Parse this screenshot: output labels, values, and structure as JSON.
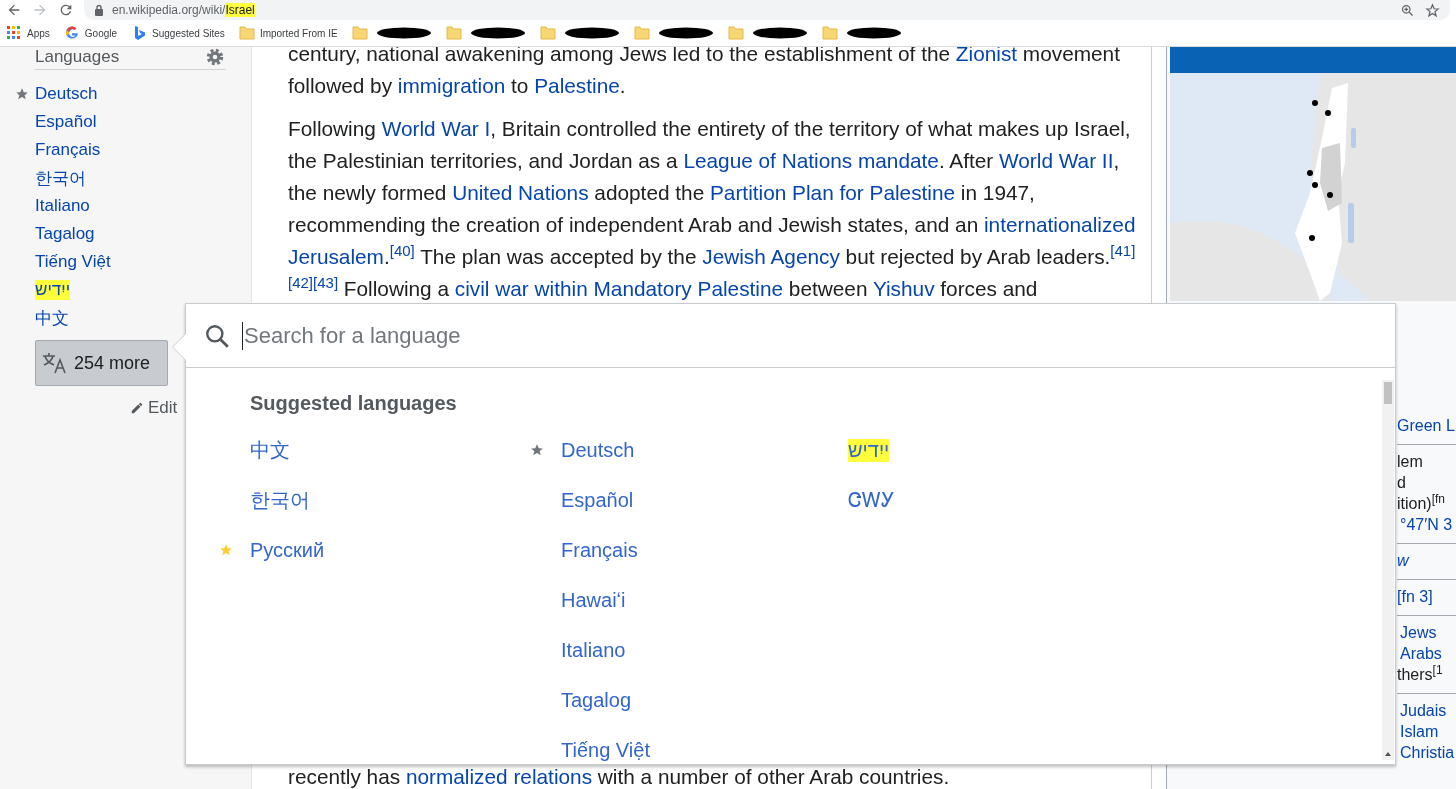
{
  "browser": {
    "nav_buttons": [
      {
        "kind": "back",
        "disabled": false
      },
      {
        "kind": "forward",
        "disabled": true
      },
      {
        "kind": "reload",
        "disabled": false
      }
    ],
    "address": [
      {
        "text": "en.wikipedia.org/wiki/",
        "highlighted": false
      },
      {
        "text": "Israel",
        "highlighted": true
      }
    ],
    "actions": [
      {
        "kind": "zoom"
      },
      {
        "kind": "bookmark"
      }
    ]
  },
  "bookmarks": [
    {
      "kind": "apps",
      "label": "Apps"
    },
    {
      "kind": "google",
      "label": "Google"
    },
    {
      "kind": "bing",
      "label": "Suggested Sites"
    },
    {
      "kind": "folder",
      "label": "Imported From IE"
    },
    {
      "kind": "redacted"
    },
    {
      "kind": "redacted"
    },
    {
      "kind": "redacted"
    },
    {
      "kind": "redacted"
    },
    {
      "kind": "redacted"
    },
    {
      "kind": "redacted"
    }
  ],
  "sidebar": {
    "heading": "Languages",
    "languages": [
      {
        "label": "Deutsch",
        "starred": true,
        "color": "#72777d",
        "highlighted": false
      },
      {
        "label": "Español",
        "starred": false,
        "highlighted": false
      },
      {
        "label": "Français",
        "starred": false,
        "highlighted": false
      },
      {
        "label": "한국어",
        "starred": false,
        "highlighted": false
      },
      {
        "label": "Italiano",
        "starred": false,
        "highlighted": false
      },
      {
        "label": "Tagalog",
        "starred": false,
        "highlighted": false
      },
      {
        "label": "Tiếng Việt",
        "starred": false,
        "highlighted": false
      },
      {
        "label": "ייִדיש",
        "starred": false,
        "highlighted": true
      },
      {
        "label": "中文",
        "starred": false,
        "highlighted": false
      }
    ],
    "more_button": "254 more",
    "edit_link": "Edit"
  },
  "article": {
    "paragraphs": [
      [
        {
          "kind": "text",
          "text": "century, national awakening among Jews led to the establishment of the "
        },
        {
          "kind": "link",
          "text": "Zionist"
        },
        {
          "kind": "text",
          "text": " movement followed by "
        },
        {
          "kind": "link",
          "text": "immigration"
        },
        {
          "kind": "text",
          "text": " to "
        },
        {
          "kind": "link",
          "text": "Palestine"
        },
        {
          "kind": "text",
          "text": "."
        }
      ],
      [
        {
          "kind": "text",
          "text": "Following "
        },
        {
          "kind": "link",
          "text": "World War I"
        },
        {
          "kind": "text",
          "text": ", Britain controlled the entirety of the territory of what makes up Israel, the Palestinian territories, and Jordan as a "
        },
        {
          "kind": "link",
          "text": "League of Nations mandate"
        },
        {
          "kind": "text",
          "text": ". After "
        },
        {
          "kind": "link",
          "text": "World War II"
        },
        {
          "kind": "text",
          "text": ", the newly formed "
        },
        {
          "kind": "link",
          "text": "United Nations"
        },
        {
          "kind": "text",
          "text": " adopted the "
        },
        {
          "kind": "link",
          "text": "Partition Plan for Palestine"
        },
        {
          "kind": "text",
          "text": " in 1947, recommending the creation of independent Arab and Jewish states, and an "
        },
        {
          "kind": "link",
          "text": "internationalized "
        },
        {
          "kind": "link",
          "text": "Jerusalem"
        },
        {
          "kind": "text",
          "text": "."
        },
        {
          "kind": "ref",
          "text": "[40]"
        },
        {
          "kind": "text",
          "text": " The plan was accepted by the "
        },
        {
          "kind": "link",
          "text": "Jewish Agency"
        },
        {
          "kind": "text",
          "text": " but rejected by Arab leaders."
        },
        {
          "kind": "ref",
          "text": "[41]"
        },
        {
          "kind": "ref",
          "text": "[42]"
        },
        {
          "kind": "ref",
          "text": "[43]"
        },
        {
          "kind": "text",
          "text": " Following a "
        },
        {
          "kind": "link",
          "text": "civil war within Mandatory Palestine"
        },
        {
          "kind": "text",
          "text": " between "
        },
        {
          "kind": "link",
          "text": "Yishuv"
        },
        {
          "kind": "text",
          "text": " forces and"
        }
      ]
    ],
    "bottom_line": [
      {
        "kind": "text",
        "text": "recently has "
      },
      {
        "kind": "link",
        "text": "normalized relations"
      },
      {
        "kind": "text",
        "text": " with a number of other Arab countries."
      }
    ]
  },
  "infobox": {
    "map": {
      "kind": "picture"
    },
    "groups": [
      [
        {
          "kind": "link",
          "text": "Green L"
        }
      ],
      [
        {
          "kind": "text",
          "text": "lem"
        },
        {
          "kind": "text",
          "text": "d"
        },
        {
          "kind": "text",
          "text": "ition)$^{[fn}$"
        },
        {
          "kind": "link",
          "text": "°47′N 3"
        }
      ],
      [
        {
          "kind": "italic",
          "text": "w"
        }
      ],
      [
        {
          "kind": "link",
          "text": "[fn 3]"
        }
      ],
      [
        {
          "kind": "link",
          "text": "Jews"
        },
        {
          "kind": "link",
          "text": "Arabs"
        },
        {
          "kind": "text",
          "text": "thers$^{[1}$"
        }
      ],
      [
        {
          "kind": "link",
          "text": "Judais"
        },
        {
          "kind": "link",
          "text": "Islam"
        },
        {
          "kind": "link",
          "text": "Christia"
        }
      ]
    ]
  },
  "language_popup": {
    "search_placeholder": "Search for a language",
    "heading": "Suggested languages",
    "columns": [
      [
        {
          "label": "中文",
          "starred": false,
          "highlighted": false
        },
        {
          "label": "한국어",
          "starred": false,
          "highlighted": false
        },
        {
          "label": "Русский",
          "starred": true,
          "color": "#ffcc33",
          "highlighted": false
        }
      ],
      [
        {
          "label": "Deutsch",
          "starred": true,
          "color": "#72777d",
          "highlighted": false
        },
        {
          "label": "Español",
          "starred": false,
          "highlighted": false
        },
        {
          "label": "Français",
          "starred": false,
          "highlighted": false
        },
        {
          "label": "Hawaiʻi",
          "starred": false,
          "highlighted": false
        },
        {
          "label": "Italiano",
          "starred": false,
          "highlighted": false
        },
        {
          "label": "Tagalog",
          "starred": false,
          "highlighted": false
        },
        {
          "label": "Tiếng Việt",
          "starred": false,
          "highlighted": false
        }
      ],
      [
        {
          "label": "ייִדיש",
          "starred": false,
          "highlighted": true
        },
        {
          "label": "ᏣᎳᎩ",
          "starred": false,
          "highlighted": false
        }
      ]
    ]
  }
}
